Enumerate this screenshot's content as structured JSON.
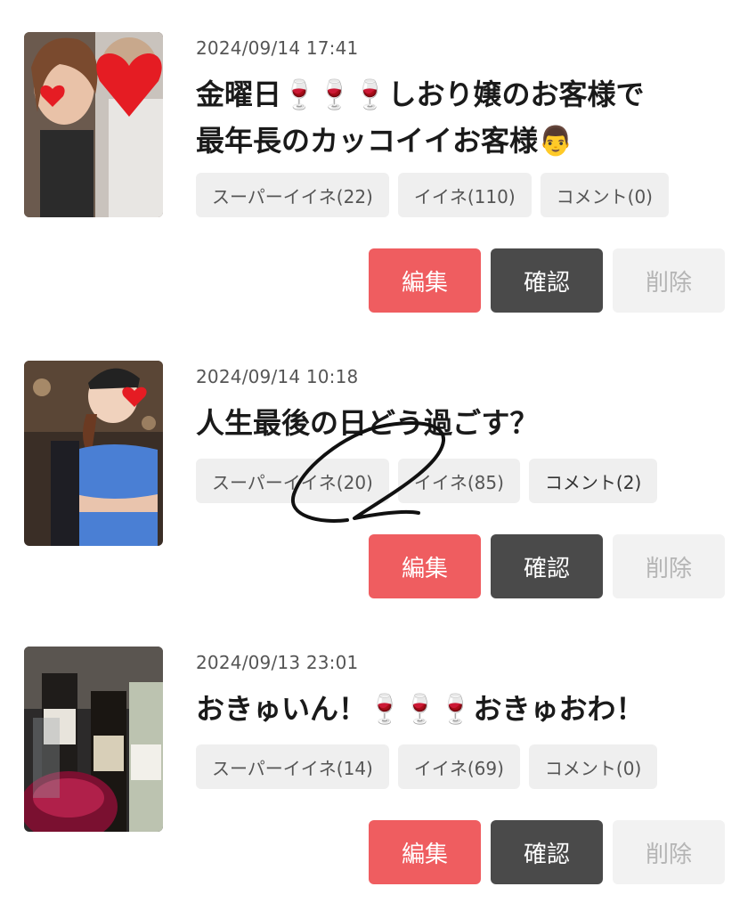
{
  "posts": [
    {
      "date": "2024/09/14 17:41",
      "title_line1": "金曜日🍷🍷🍷しおり嬢のお客様で",
      "title_line2": "最年長のカッコイイお客様👨",
      "super_like": "スーパーイイネ(22)",
      "like": "イイネ(110)",
      "comment": "コメント(0)",
      "thumb_icon": "photo-couple-icon"
    },
    {
      "date": "2024/09/14 10:18",
      "title_line1": "人生最後の日どう過ごす？",
      "title_line2": "",
      "super_like": "スーパーイイネ(20)",
      "like": "イイネ(85)",
      "comment": "コメント(2)",
      "thumb_icon": "photo-woman-icon"
    },
    {
      "date": "2024/09/13 23:01",
      "title_line1": "おきゅいん！🍷🍷🍷おきゅおわ！",
      "title_line2": "",
      "super_like": "スーパーイイネ(14)",
      "like": "イイネ(69)",
      "comment": "コメント(0)",
      "thumb_icon": "photo-wine-icon"
    }
  ],
  "buttons": {
    "edit": "編集",
    "confirm": "確認",
    "delete": "削除"
  },
  "colors": {
    "edit": "#ef5d60",
    "confirm": "#4a4a4a",
    "delete": "#f2f2f2",
    "chip": "#efefef"
  }
}
